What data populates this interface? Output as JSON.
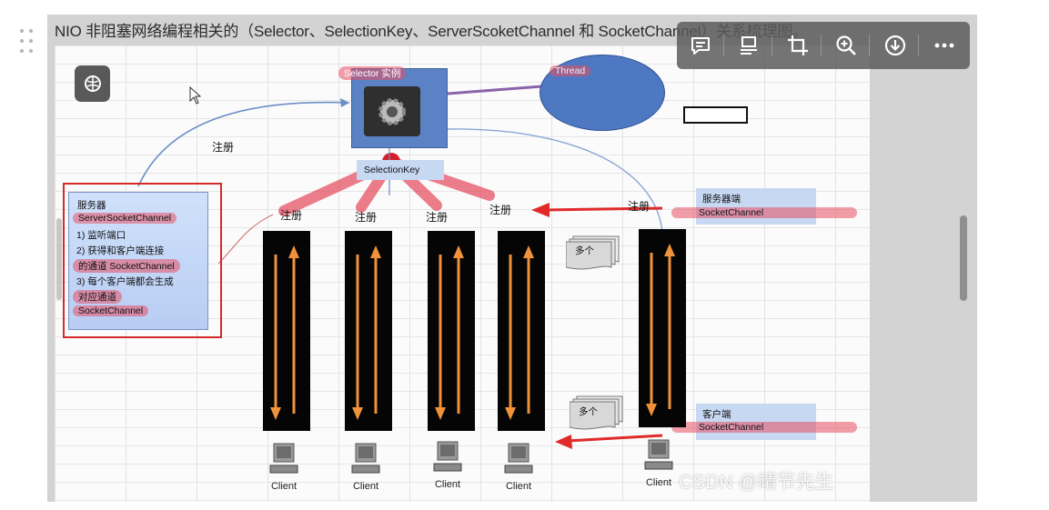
{
  "caption": "NIO 非阻塞网络编程相关的（Selector、SelectionKey、ServerScoketChannel 和 SocketChannel）关系梳理图。",
  "toolbar": {
    "icons": [
      "comment-icon",
      "ocr-text-icon",
      "crop-icon",
      "zoom-in-icon",
      "download-icon",
      "more-icon"
    ]
  },
  "diagram": {
    "selector_label": "Selector 实例",
    "thread_label": "Thread",
    "selectionkey_label": "SelectionKey",
    "register": "注册",
    "server": {
      "title": "服务器",
      "line1": "ServerSocketChannel",
      "line2": "1) 监听端口",
      "line3": "2) 获得和客户端连接",
      "line4": "的通道 SocketChannel",
      "line5": "3) 每个客户端都会生成",
      "line6": "对应通道",
      "line7": "SocketChannel"
    },
    "server_side": {
      "title": "服务器端",
      "sub": "SocketChannel"
    },
    "client_side": {
      "title": "客户端",
      "sub": "SocketChannel"
    },
    "many": "多个",
    "client": "Client"
  },
  "watermark": "CSDN @靖节先生",
  "colors": {
    "accent_red": "#e02a2a",
    "arrow_orange": "#f0923a",
    "selector_blue": "#5b82c4"
  }
}
